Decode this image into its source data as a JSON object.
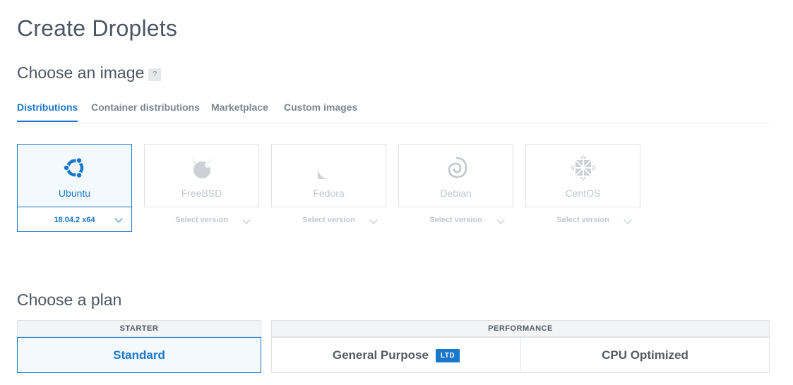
{
  "page": {
    "title": "Create Droplets"
  },
  "image_section": {
    "title": "Choose an image",
    "help": "?",
    "tabs": [
      {
        "label": "Distributions",
        "active": true
      },
      {
        "label": "Container distributions",
        "active": false
      },
      {
        "label": "Marketplace",
        "active": false
      },
      {
        "label": "Custom images",
        "active": false
      }
    ],
    "distributions": [
      {
        "name": "Ubuntu",
        "version": "18.04.2 x64",
        "selected": true,
        "icon": "ubuntu-icon"
      },
      {
        "name": "FreeBSD",
        "version": "Select version",
        "selected": false,
        "icon": "freebsd-icon"
      },
      {
        "name": "Fedora",
        "version": "Select version",
        "selected": false,
        "icon": "fedora-icon"
      },
      {
        "name": "Debian",
        "version": "Select version",
        "selected": false,
        "icon": "debian-icon"
      },
      {
        "name": "CentOS",
        "version": "Select version",
        "selected": false,
        "icon": "centos-icon"
      }
    ]
  },
  "plan_section": {
    "title": "Choose a plan",
    "groups": [
      {
        "label": "STARTER"
      },
      {
        "label": "PERFORMANCE"
      }
    ],
    "plans": [
      {
        "label": "Standard",
        "selected": true
      },
      {
        "label": "General Purpose",
        "badge": "LTD",
        "selected": false
      },
      {
        "label": "CPU Optimized",
        "selected": false
      }
    ]
  },
  "colors": {
    "accent": "#1b77c9",
    "border": "#dfe2e6",
    "selected_bg": "#f3f9fe"
  }
}
